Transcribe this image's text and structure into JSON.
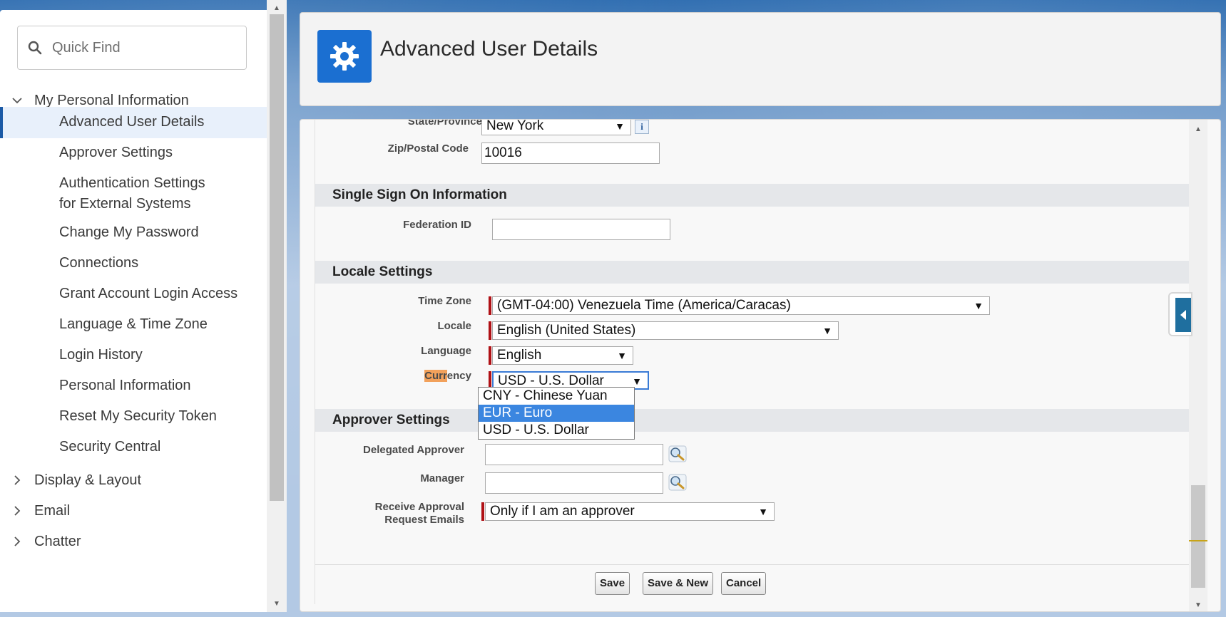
{
  "sidebar": {
    "quick_find_placeholder": "Quick Find",
    "sections": {
      "my_personal_information": "My Personal Information",
      "display_layout": "Display & Layout",
      "email": "Email",
      "chatter": "Chatter"
    },
    "items": [
      {
        "label": "Advanced User Details",
        "active": true
      },
      {
        "label": "Approver Settings"
      },
      {
        "label": "Authentication Settings for External Systems"
      },
      {
        "label": "Change My Password"
      },
      {
        "label": "Connections"
      },
      {
        "label": "Grant Account Login Access"
      },
      {
        "label": "Language & Time Zone"
      },
      {
        "label": "Login History"
      },
      {
        "label": "Personal Information"
      },
      {
        "label": "Reset My Security Token"
      },
      {
        "label": "Security Central"
      }
    ]
  },
  "header": {
    "title": "Advanced User Details",
    "icon": "gear-icon"
  },
  "form": {
    "state_label": "State/Province",
    "state_value": "New York",
    "zip_label": "Zip/Postal Code",
    "zip_value": "10016",
    "sso_header": "Single Sign On Information",
    "federation_label": "Federation ID",
    "federation_value": "",
    "locale_header": "Locale Settings",
    "timezone_label": "Time Zone",
    "timezone_value": "(GMT-04:00) Venezuela Time (America/Caracas)",
    "locale_label": "Locale",
    "locale_value": "English (United States)",
    "language_label": "Language",
    "language_value": "English",
    "currency_label_hl": "Curr",
    "currency_label_rest": "ency",
    "currency_value": "USD - U.S. Dollar",
    "currency_options": [
      "CNY - Chinese Yuan",
      "EUR - Euro",
      "USD - U.S. Dollar"
    ],
    "approver_header": "Approver Settings",
    "delegated_label": "Delegated Approver",
    "manager_label": "Manager",
    "receive_label_1": "Receive Approval",
    "receive_label_2": "Request Emails",
    "receive_value": "Only if I am an approver"
  },
  "buttons": {
    "save": "Save",
    "save_new": "Save & New",
    "cancel": "Cancel"
  },
  "colors": {
    "brand_blue": "#1b6fd1",
    "required_red": "#b01116",
    "highlight_orange": "#f2a15b",
    "option_selected": "#3b86e0"
  }
}
